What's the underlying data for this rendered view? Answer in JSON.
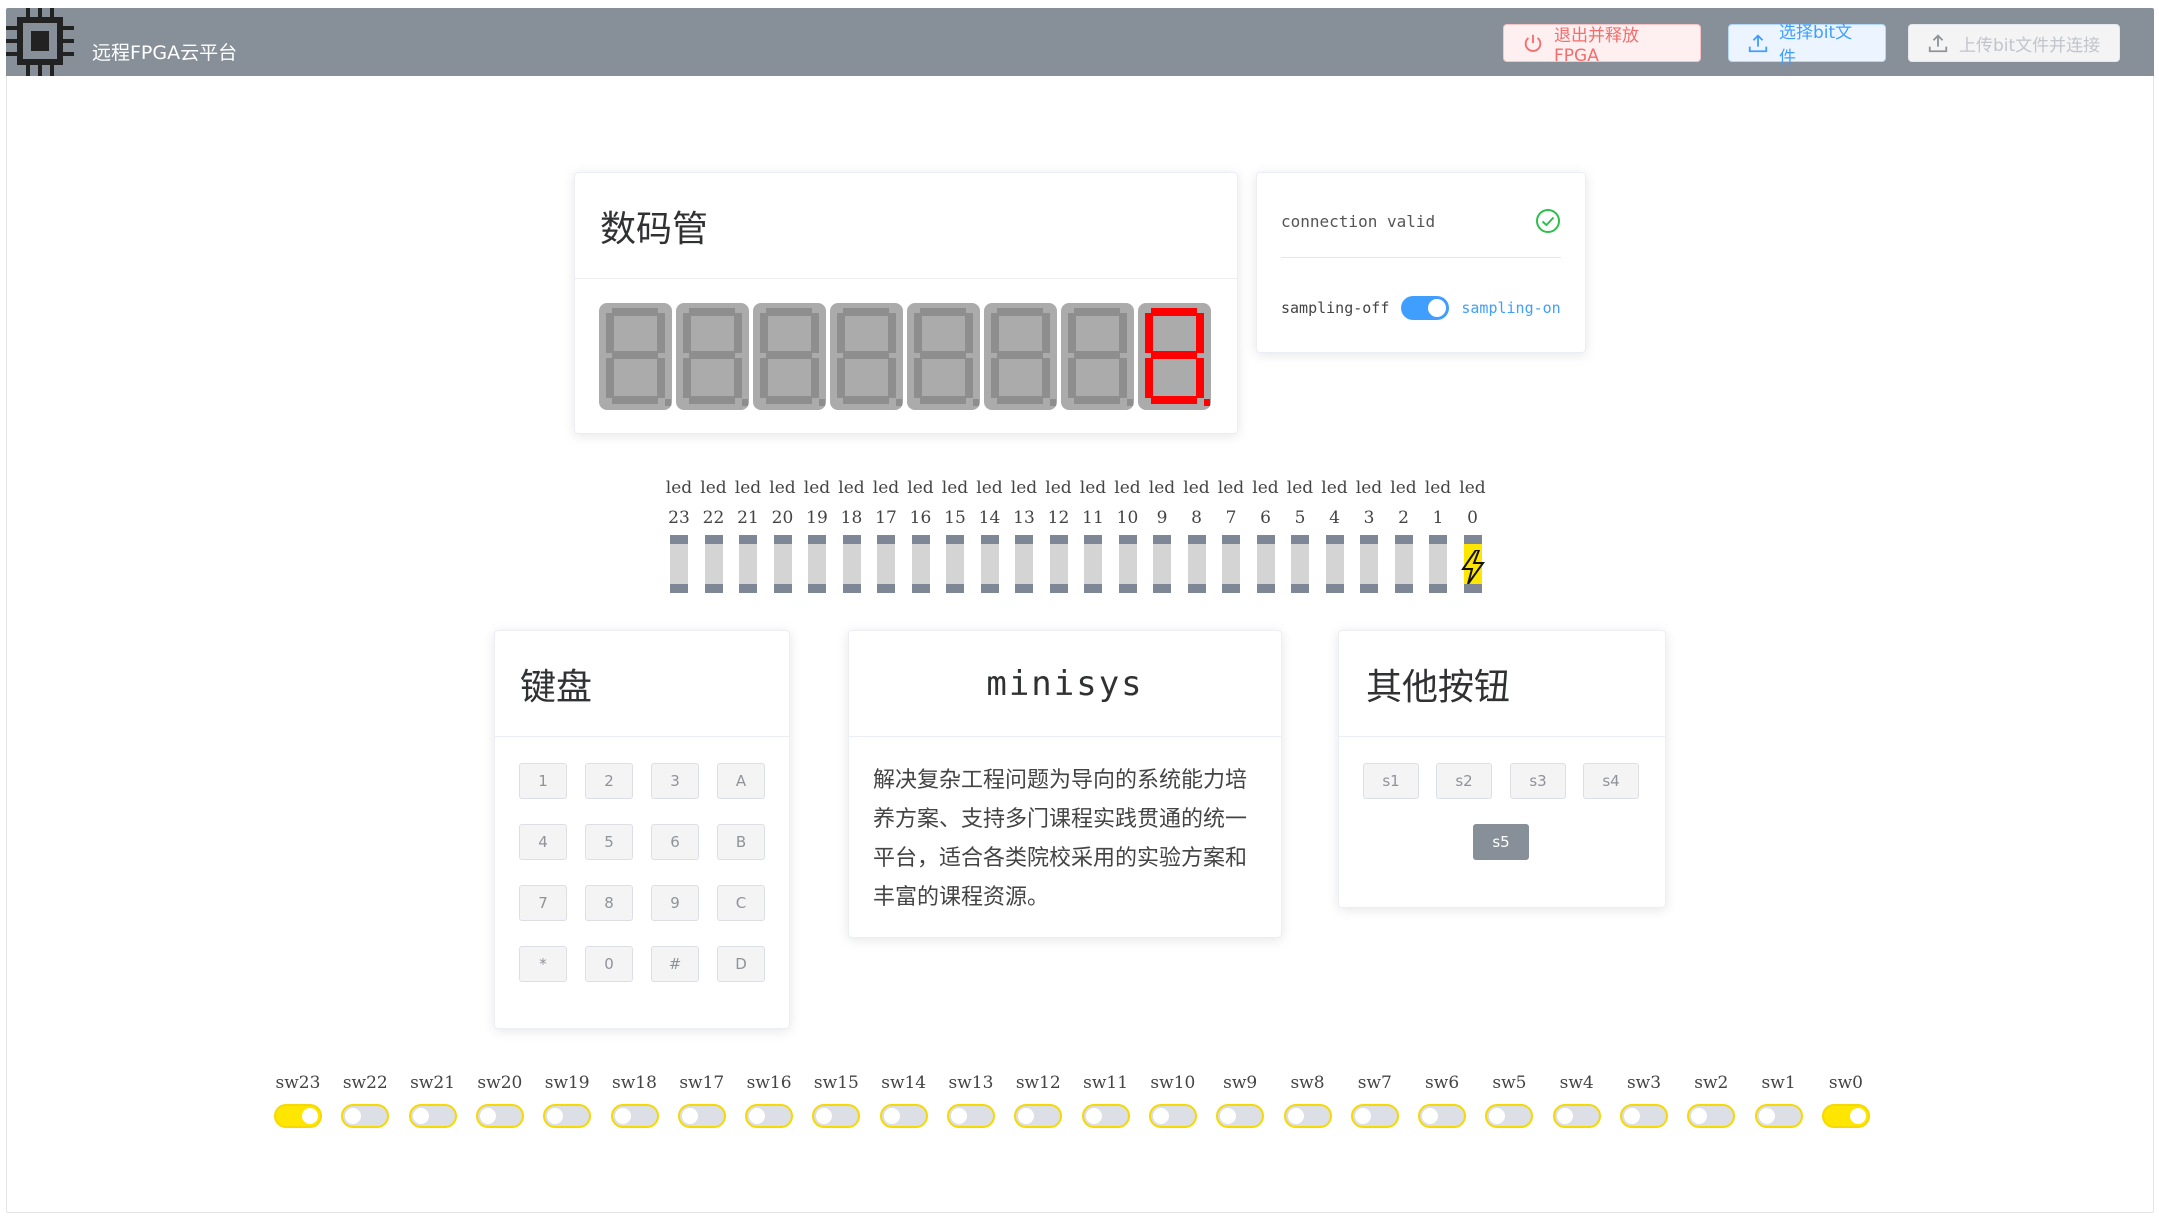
{
  "header": {
    "title": "远程FPGA云平台",
    "exit_label": "退出并释放FPGA",
    "select_label": "选择bit文件",
    "upload_label": "上传bit文件并连接"
  },
  "seg": {
    "title": "数码管",
    "active_digit_index": 7,
    "colors": {
      "off": "#8e8e8e",
      "on": "#ff0000",
      "bg": "#ababab"
    }
  },
  "connection": {
    "status": "connection valid",
    "sampling_off": "sampling-off",
    "sampling_on": "sampling-on",
    "sampling_enabled": true
  },
  "leds": {
    "prefix": "led",
    "items": [
      {
        "num": "23",
        "on": false
      },
      {
        "num": "22",
        "on": false
      },
      {
        "num": "21",
        "on": false
      },
      {
        "num": "20",
        "on": false
      },
      {
        "num": "19",
        "on": false
      },
      {
        "num": "18",
        "on": false
      },
      {
        "num": "17",
        "on": false
      },
      {
        "num": "16",
        "on": false
      },
      {
        "num": "15",
        "on": false
      },
      {
        "num": "14",
        "on": false
      },
      {
        "num": "13",
        "on": false
      },
      {
        "num": "12",
        "on": false
      },
      {
        "num": "11",
        "on": false
      },
      {
        "num": "10",
        "on": false
      },
      {
        "num": "9",
        "on": false
      },
      {
        "num": "8",
        "on": false
      },
      {
        "num": "7",
        "on": false
      },
      {
        "num": "6",
        "on": false
      },
      {
        "num": "5",
        "on": false
      },
      {
        "num": "4",
        "on": false
      },
      {
        "num": "3",
        "on": false
      },
      {
        "num": "2",
        "on": false
      },
      {
        "num": "1",
        "on": false
      },
      {
        "num": "0",
        "on": true
      }
    ]
  },
  "keypad": {
    "title": "键盘",
    "keys": [
      "1",
      "2",
      "3",
      "A",
      "4",
      "5",
      "6",
      "B",
      "7",
      "8",
      "9",
      "C",
      "*",
      "0",
      "#",
      "D"
    ]
  },
  "minisys": {
    "title": "minisys",
    "description": "解决复杂工程问题为导向的系统能力培养方案、支持多门课程实践贯通的统一平台，适合各类院校采用的实验方案和丰富的课程资源。"
  },
  "other": {
    "title": "其他按钮",
    "buttons": [
      {
        "label": "s1",
        "active": false
      },
      {
        "label": "s2",
        "active": false
      },
      {
        "label": "s3",
        "active": false
      },
      {
        "label": "s4",
        "active": false
      },
      {
        "label": "s5",
        "active": true
      }
    ]
  },
  "switches": [
    {
      "label": "sw23",
      "on": true
    },
    {
      "label": "sw22",
      "on": false
    },
    {
      "label": "sw21",
      "on": false
    },
    {
      "label": "sw20",
      "on": false
    },
    {
      "label": "sw19",
      "on": false
    },
    {
      "label": "sw18",
      "on": false
    },
    {
      "label": "sw17",
      "on": false
    },
    {
      "label": "sw16",
      "on": false
    },
    {
      "label": "sw15",
      "on": false
    },
    {
      "label": "sw14",
      "on": false
    },
    {
      "label": "sw13",
      "on": false
    },
    {
      "label": "sw12",
      "on": false
    },
    {
      "label": "sw11",
      "on": false
    },
    {
      "label": "sw10",
      "on": false
    },
    {
      "label": "sw9",
      "on": false
    },
    {
      "label": "sw8",
      "on": false
    },
    {
      "label": "sw7",
      "on": false
    },
    {
      "label": "sw6",
      "on": false
    },
    {
      "label": "sw5",
      "on": false
    },
    {
      "label": "sw4",
      "on": false
    },
    {
      "label": "sw3",
      "on": false
    },
    {
      "label": "sw2",
      "on": false
    },
    {
      "label": "sw1",
      "on": false
    },
    {
      "label": "sw0",
      "on": true
    }
  ],
  "icons": {
    "logo": "chip-icon",
    "exit": "power-icon",
    "select": "upload-icon",
    "upload": "upload-icon",
    "status": "check-circle-icon",
    "led_active": "lightning-icon"
  }
}
